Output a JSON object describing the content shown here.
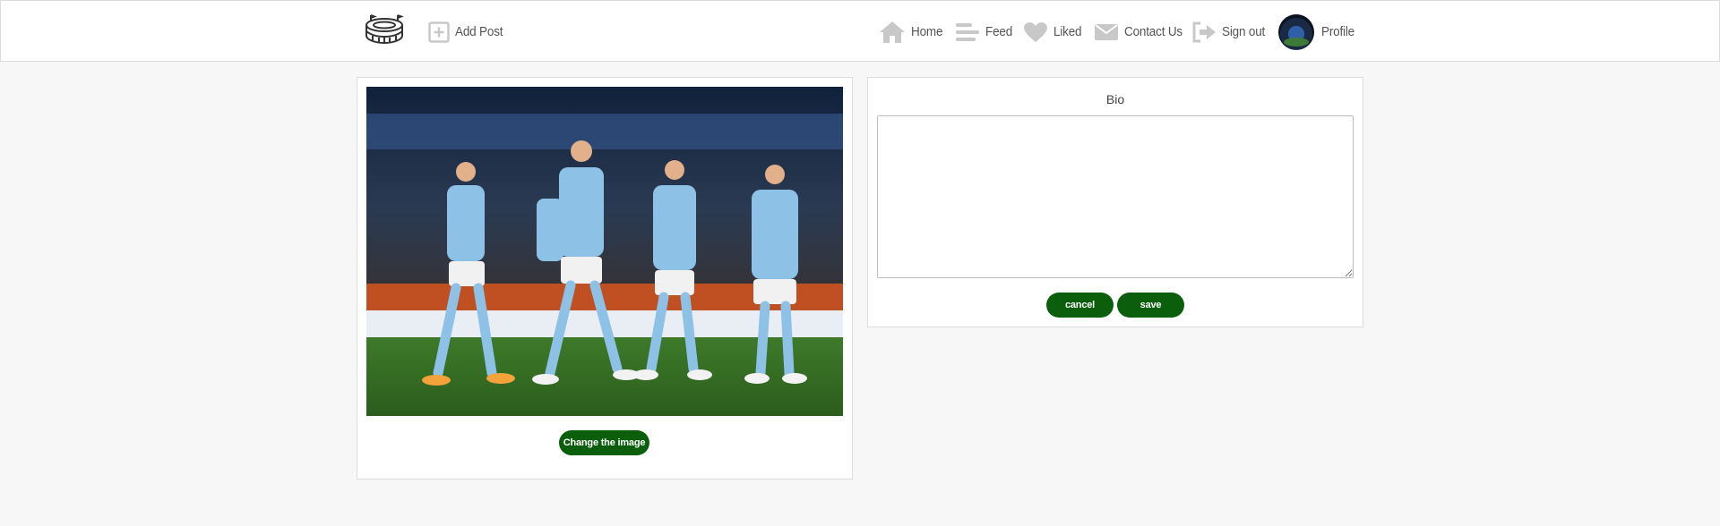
{
  "nav": {
    "add_post": "Add Post",
    "home": "Home",
    "feed": "Feed",
    "liked": "Liked",
    "contact": "Contact Us",
    "signout": "Sign out",
    "profile": "Profile"
  },
  "icons": {
    "logo": "stadium-icon",
    "add_post": "plus-square-icon",
    "home": "home-icon",
    "feed": "bars-icon",
    "liked": "heart-icon",
    "contact": "envelope-icon",
    "signout": "sign-out-icon"
  },
  "image_card": {
    "change_button": "Change the image"
  },
  "bio_card": {
    "title": "Bio",
    "value": "",
    "cancel_button": "cancel",
    "save_button": "save"
  },
  "colors": {
    "button_green": "#0b5e0b",
    "icon_gray": "#c8c8c8",
    "background": "#f7f7f7"
  }
}
